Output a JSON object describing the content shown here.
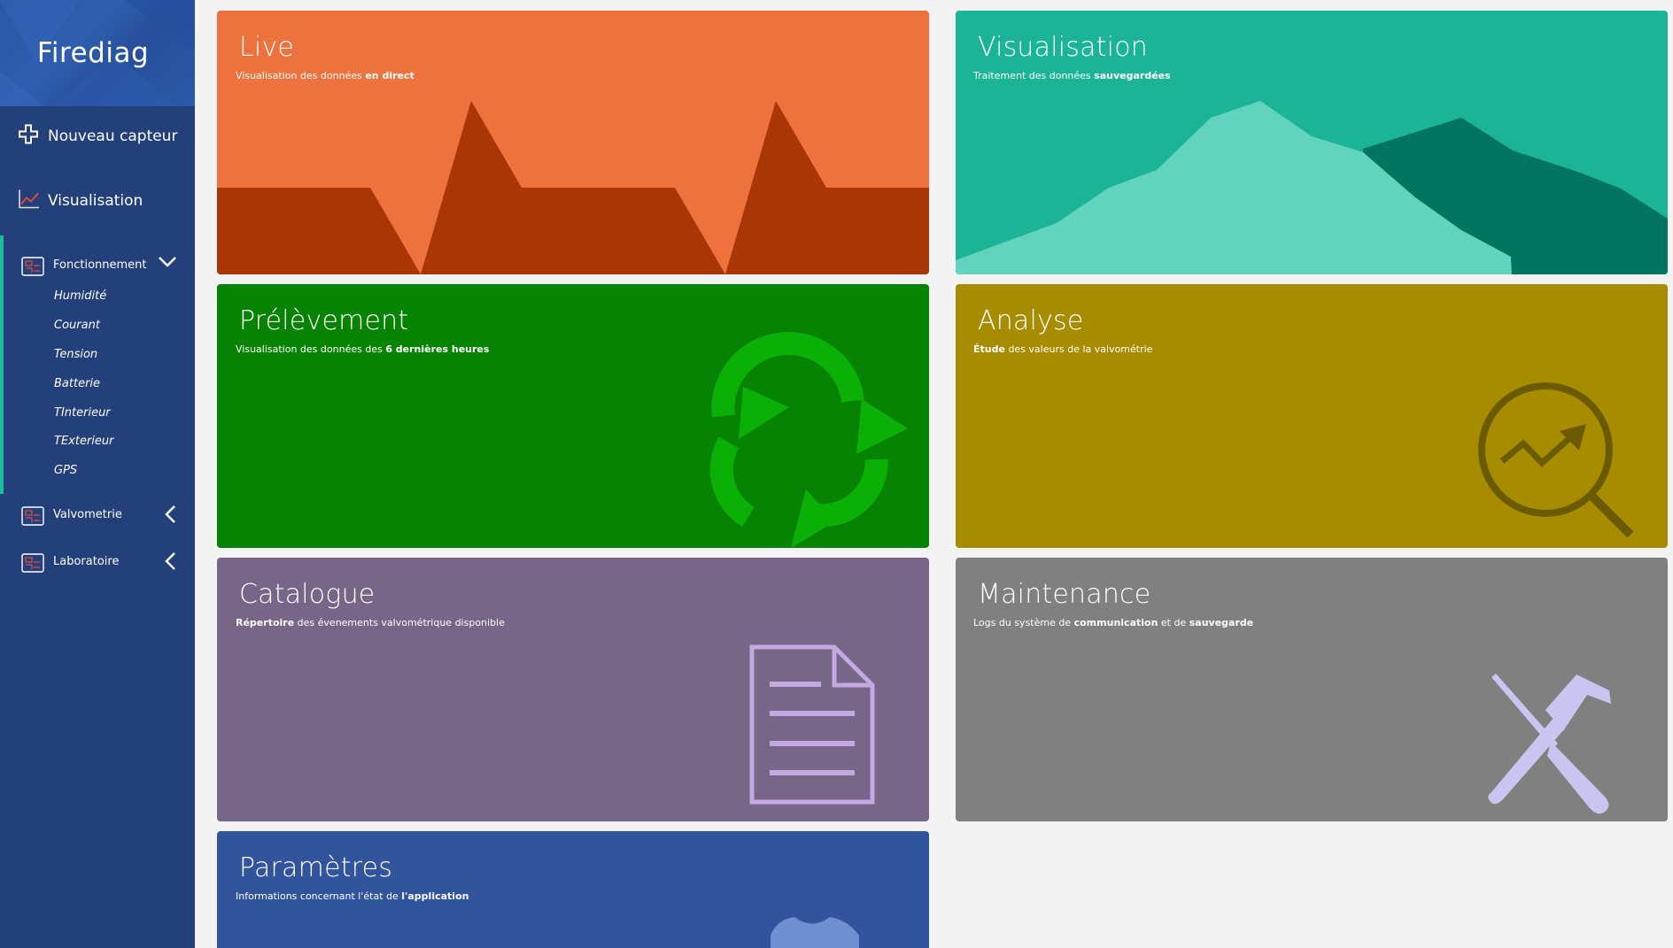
{
  "sidebar": {
    "brand": "Firediag",
    "nav": [
      {
        "label": "Nouveau capteur",
        "icon": "plus-cross-icon"
      },
      {
        "label": "Visualisation",
        "icon": "line-chart-icon"
      }
    ],
    "groups": [
      {
        "label": "Fonctionnement",
        "icon": "dashboard-icon",
        "expanded": true,
        "items": [
          "Humidité",
          "Courant",
          "Tension",
          "Batterie",
          "TInterieur",
          "TExterieur",
          "GPS"
        ]
      },
      {
        "label": "Valvometrie",
        "icon": "dashboard-icon",
        "expanded": false
      },
      {
        "label": "Laboratoire",
        "icon": "dashboard-icon",
        "expanded": false
      }
    ]
  },
  "tiles": {
    "live": {
      "title": "Live",
      "sub_a": "Visualisation des données ",
      "sub_b": "en direct",
      "color": "#ed723e",
      "icon": "heartbeat-wave-icon"
    },
    "visualisation": {
      "title": "Visualisation",
      "sub_a": "Traitement des données ",
      "sub_b": "sauvegardées",
      "color": "#1bb497",
      "icon": "mountain-area-icon"
    },
    "prelevement": {
      "title": "Prélèvement",
      "sub_a": "Visualisation des données des ",
      "sub_b": "6 dernières heures",
      "color": "#078304",
      "icon": "recycle-arrows-icon"
    },
    "analyse": {
      "title": "Analyse",
      "sub_a": "Étude",
      "sub_b": " des valeurs de la valvométrie",
      "color": "#a78c00",
      "icon": "magnifier-trend-icon"
    },
    "catalogue": {
      "title": "Catalogue",
      "sub_a": "Répertoire",
      "sub_b": " des évenements valvométrique disponible",
      "color": "#786688",
      "icon": "document-icon"
    },
    "maintenance": {
      "title": "Maintenance",
      "sub_a": "Logs du système de ",
      "sub_b": "communication",
      "sub_c": " et de ",
      "sub_d": "sauvegarde",
      "color": "#808080",
      "icon": "tools-icon"
    },
    "parametres": {
      "title": "Paramètres",
      "sub_a": "Informations concernant l'état de ",
      "sub_b": "l'application",
      "color": "#31549c",
      "icon": "gear-icon"
    }
  }
}
